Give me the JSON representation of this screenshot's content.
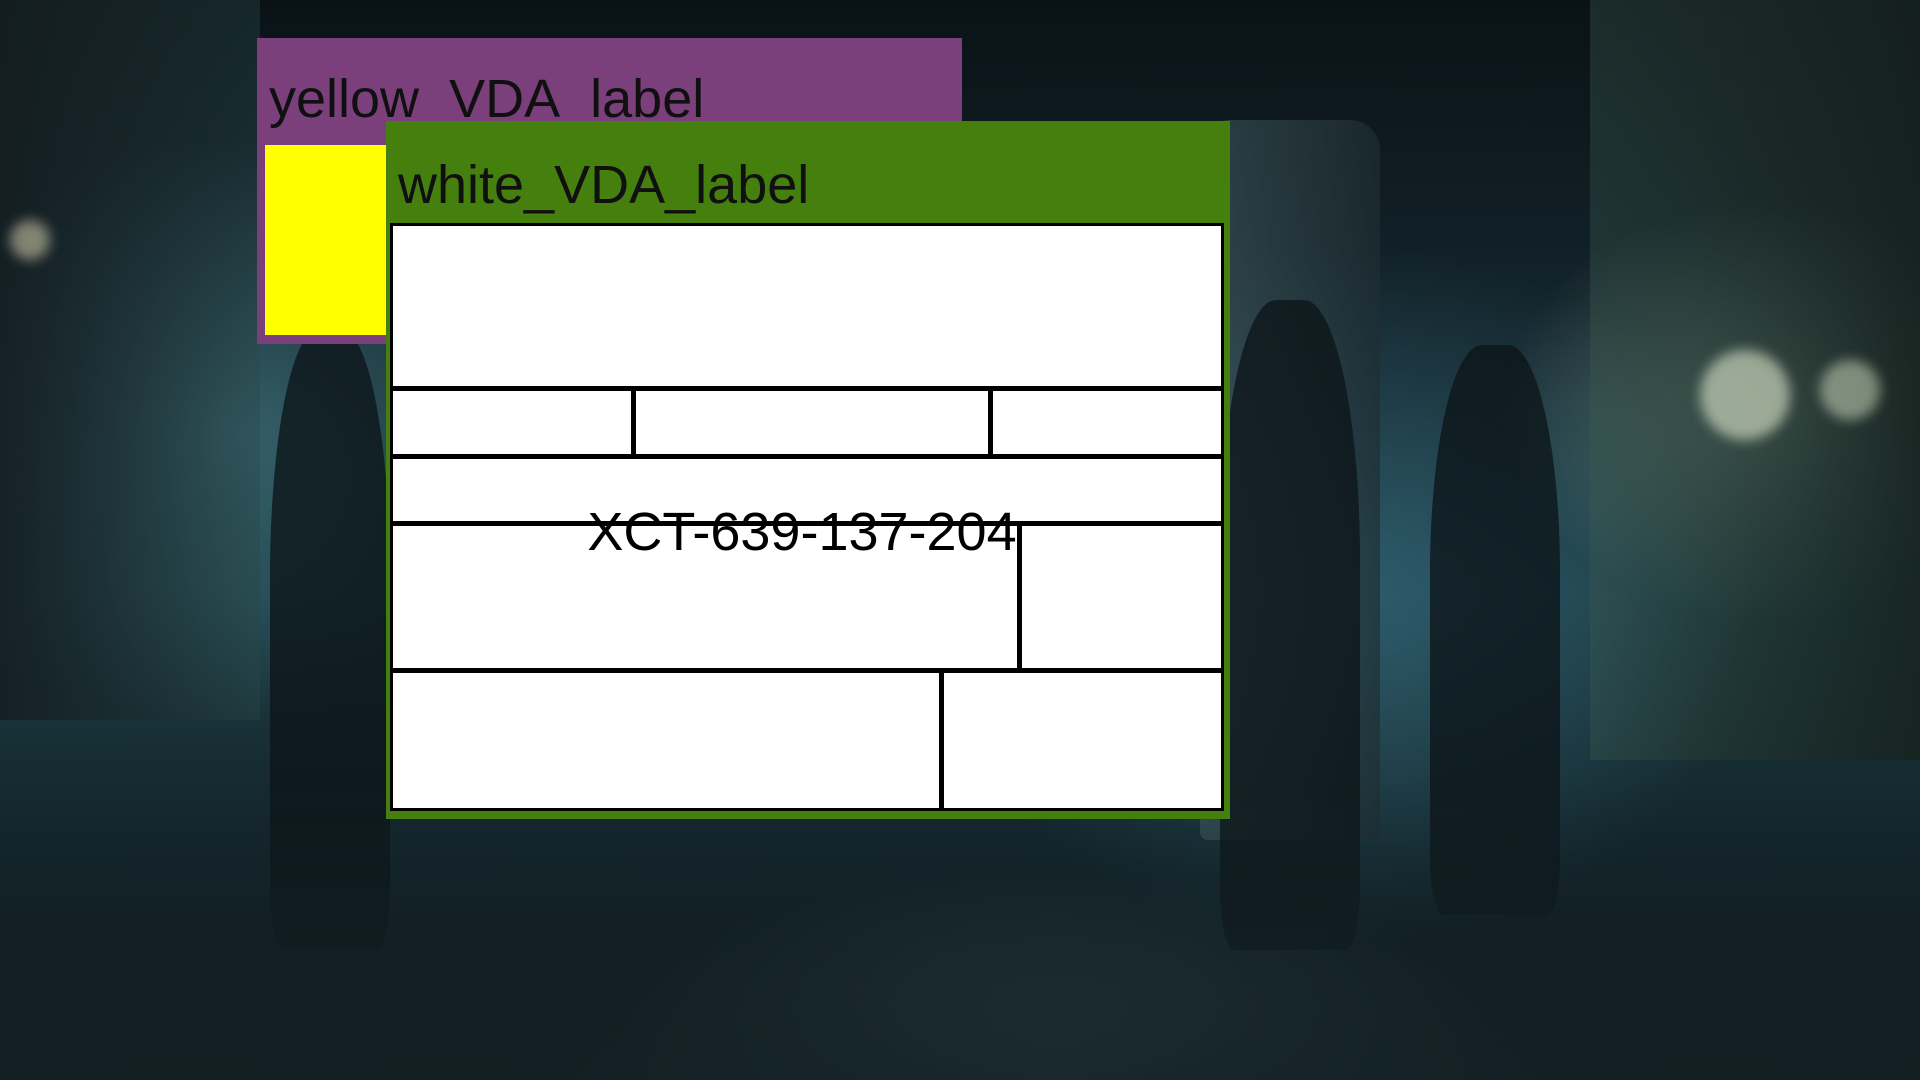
{
  "yellow_panel": {
    "label": "yellow_VDA_label",
    "panel_color": "#7b3f7c",
    "swatch_color": "#ffff00"
  },
  "white_panel": {
    "label": "white_VDA_label",
    "panel_color": "#45800e",
    "code": "XCT-639-137-204"
  },
  "background": {
    "icon": "city-street-scene-image"
  }
}
